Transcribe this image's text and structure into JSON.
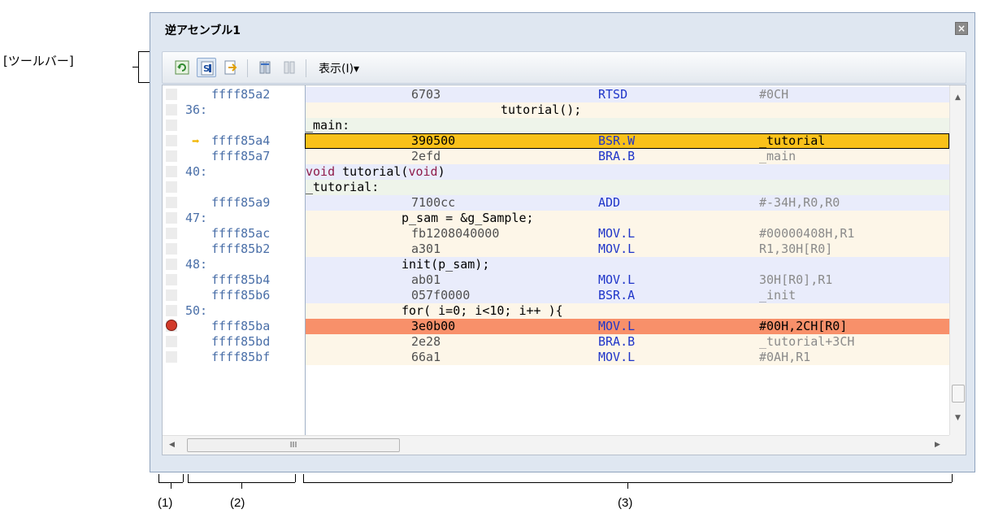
{
  "annotations": {
    "toolbar_label": "[ツールバー]",
    "areas": [
      "(1)",
      "(2)",
      "(3)"
    ]
  },
  "window": {
    "title": "逆アセンブル1",
    "close_icon": "close-icon"
  },
  "toolbar": {
    "buttons": [
      {
        "name": "refresh-button",
        "icon": "refresh-icon"
      },
      {
        "name": "mixed-display-button",
        "icon": "mixed-display-icon",
        "pressed": true
      },
      {
        "name": "jump-button",
        "icon": "jump-icon"
      },
      {
        "name": "step-in-button",
        "icon": "step-in-icon"
      },
      {
        "name": "step-over-button",
        "icon": "step-over-icon"
      }
    ],
    "view_menu": "表示(I)▾"
  },
  "rows": [
    {
      "type": "asm",
      "bg": "blue",
      "addr": "ffff85a2",
      "code": "6703",
      "mnem": "RTSD",
      "oper": "#0CH"
    },
    {
      "type": "src",
      "bg": "cream",
      "lineno": "36:",
      "text": "tutorial();",
      "indent": 240
    },
    {
      "type": "label",
      "bg": "green",
      "text": "_main:"
    },
    {
      "type": "asm",
      "bg": "current",
      "addr": "ffff85a4",
      "code": "390500",
      "mnem": "BSR.W",
      "oper": "_tutorial",
      "arrow": true
    },
    {
      "type": "asm",
      "bg": "cream",
      "addr": "ffff85a7",
      "code": "2efd",
      "mnem": "BRA.B",
      "oper": "_main"
    },
    {
      "type": "src",
      "bg": "blue",
      "lineno": "40:",
      "text": "void tutorial(void)",
      "indent": 0
    },
    {
      "type": "label",
      "bg": "green",
      "text": "_tutorial:"
    },
    {
      "type": "asm",
      "bg": "blue",
      "addr": "ffff85a9",
      "code": "7100cc",
      "mnem": "ADD",
      "oper": "#-34H,R0,R0"
    },
    {
      "type": "src",
      "bg": "cream",
      "lineno": "47:",
      "text": "p_sam = &g_Sample;",
      "indent": 118
    },
    {
      "type": "asm",
      "bg": "cream",
      "addr": "ffff85ac",
      "code": "fb1208040000",
      "mnem": "MOV.L",
      "oper": "#00000408H,R1"
    },
    {
      "type": "asm",
      "bg": "cream",
      "addr": "ffff85b2",
      "code": "a301",
      "mnem": "MOV.L",
      "oper": "R1,30H[R0]"
    },
    {
      "type": "src",
      "bg": "blue",
      "lineno": "48:",
      "text": "init(p_sam);",
      "indent": 118
    },
    {
      "type": "asm",
      "bg": "blue",
      "addr": "ffff85b4",
      "code": "ab01",
      "mnem": "MOV.L",
      "oper": "30H[R0],R1"
    },
    {
      "type": "asm",
      "bg": "blue",
      "addr": "ffff85b6",
      "code": "057f0000",
      "mnem": "BSR.A",
      "oper": "_init"
    },
    {
      "type": "src",
      "bg": "cream",
      "lineno": "50:",
      "text": "for( i=0; i<10; i++ ){",
      "indent": 118
    },
    {
      "type": "asm",
      "bg": "bp",
      "addr": "ffff85ba",
      "code": "3e0b00",
      "mnem": "MOV.L",
      "oper": "#00H,2CH[R0]",
      "breakpoint": true
    },
    {
      "type": "asm",
      "bg": "cream",
      "addr": "ffff85bd",
      "code": "2e28",
      "mnem": "BRA.B",
      "oper": "_tutorial+3CH"
    },
    {
      "type": "asm",
      "bg": "cream",
      "addr": "ffff85bf",
      "code": "66a1",
      "mnem": "MOV.L",
      "oper": "#0AH,R1"
    }
  ],
  "colors": {
    "current_line": "#f9c11a",
    "breakpoint_line": "#f8906a",
    "mnemonic": "#1f35c9",
    "address": "#4a6fa8"
  },
  "hscroll_thumb_text": "III"
}
